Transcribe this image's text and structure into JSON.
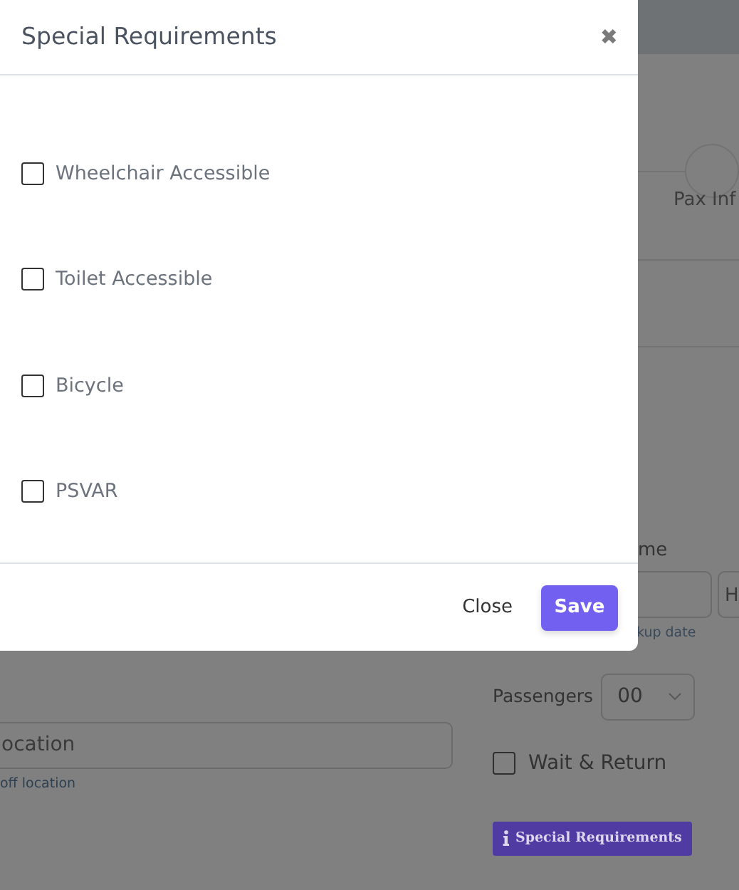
{
  "modal": {
    "title": "Special Requirements",
    "close_glyph": "✖",
    "options": [
      {
        "label": "Wheelchair Accessible",
        "checked": false
      },
      {
        "label": "Toilet Accessible",
        "checked": false
      },
      {
        "label": "Bicycle",
        "checked": false
      },
      {
        "label": "PSVAR",
        "checked": false
      }
    ],
    "buttons": [
      {
        "label": "Close",
        "kind": "link"
      },
      {
        "label": "Save",
        "kind": "primary"
      }
    ]
  },
  "background": {
    "tab_label": "Pax Inf",
    "time_label": "me",
    "time_value": "H",
    "time_hint": "kup date",
    "location_value": "ocation",
    "location_hint": "off location",
    "passengers_label": "Passengers",
    "passengers_value": "00",
    "wait_return": {
      "label": "Wait & Return",
      "checked": false
    },
    "special_button": "Special Requirements"
  }
}
